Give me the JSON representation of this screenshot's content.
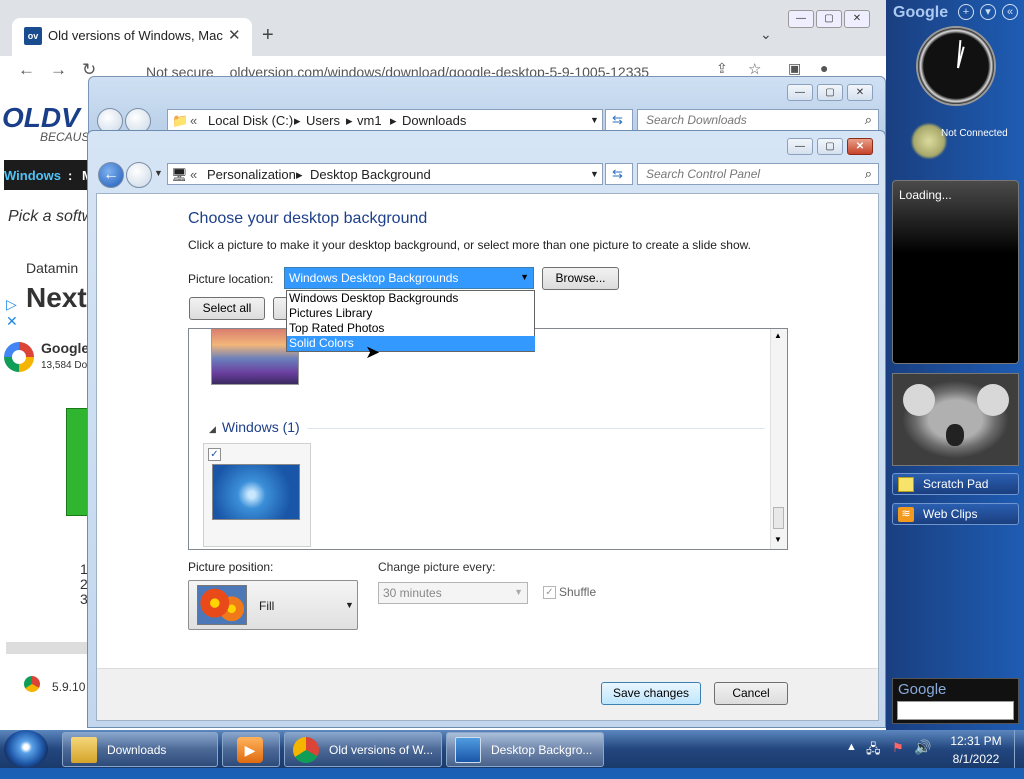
{
  "chrome": {
    "tab_title": "Old versions of Windows, Mac ar",
    "favicon_text": "ov",
    "address_prefix": "Not secure",
    "address_url": "oldversion.com/windows/download/google-desktop-5-9-1005-12335",
    "page": {
      "logo": "OLDV",
      "tagline": "BECAUS",
      "nav_item": "Windows",
      "nav_sep": ":",
      "nav_next": "M",
      "pick_text": "Pick a softw",
      "ad_source": "Datamin",
      "ad_headline": "Next",
      "app_name": "Google",
      "app_count": "13,584 Do",
      "list_numbers": [
        "1",
        "2",
        "3"
      ],
      "version": "5.9.10"
    }
  },
  "explorer": {
    "breadcrumb": [
      "Local Disk (C:)",
      "Users",
      "vm1",
      "Downloads"
    ],
    "search_placeholder": "Search Downloads"
  },
  "personalization": {
    "breadcrumb": [
      "Personalization",
      "Desktop Background"
    ],
    "search_placeholder": "Search Control Panel",
    "heading": "Choose your desktop background",
    "description": "Click a picture to make it your desktop background, or select more than one picture to create a slide show.",
    "location_label": "Picture location:",
    "location_value": "Windows Desktop Backgrounds",
    "browse_label": "Browse...",
    "select_all_label": "Select all",
    "dropdown_options": [
      {
        "label": "Windows Desktop Backgrounds",
        "selected": false
      },
      {
        "label": "Pictures Library",
        "selected": false
      },
      {
        "label": "Top Rated Photos",
        "selected": false
      },
      {
        "label": "Solid Colors",
        "selected": true
      }
    ],
    "group_label": "Windows (1)",
    "position_label": "Picture position:",
    "position_value": "Fill",
    "interval_label": "Change picture every:",
    "interval_value": "30 minutes",
    "shuffle_label": "Shuffle",
    "save_label": "Save changes",
    "cancel_label": "Cancel"
  },
  "sidebar": {
    "title": "Google",
    "status": "Not Connected",
    "loading": "Loading...",
    "gadgets": [
      "Scratch Pad",
      "Web Clips"
    ],
    "search_logo": "Google"
  },
  "taskbar": {
    "items": [
      {
        "label": "Downloads",
        "active": false
      },
      {
        "label": "",
        "active": false
      },
      {
        "label": "Old versions of W...",
        "active": false
      },
      {
        "label": "Desktop Backgro...",
        "active": true
      }
    ],
    "time": "12:31 PM",
    "date": "8/1/2022"
  },
  "colors": {
    "accent": "#3399ff",
    "heading": "#1e3f8a",
    "desktop": "#1d5aa8"
  }
}
